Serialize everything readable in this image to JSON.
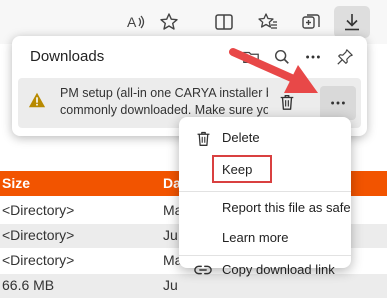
{
  "toolbar": {
    "icons": [
      "read-aloud-icon",
      "favorite-star-icon",
      "split-screen-icon",
      "favorites-icon",
      "collections-icon",
      "downloads-icon"
    ]
  },
  "downloads": {
    "title": "Downloads",
    "item": {
      "line1": "PM setup (all-in one CARYA installer ba",
      "line2": "commonly downloaded. Make sure you"
    }
  },
  "menu": {
    "delete": "Delete",
    "keep": "Keep",
    "report": "Report this file as safe",
    "learn_more": "Learn more",
    "copy_link": "Copy download link"
  },
  "table": {
    "headers": [
      "Size",
      "Da"
    ],
    "rows": [
      {
        "size": "<Directory>",
        "date": "Ma"
      },
      {
        "size": "<Directory>",
        "date": "Ju"
      },
      {
        "size": "<Directory>",
        "date": "Ma"
      },
      {
        "size": "66.6 MB",
        "date": "Ju"
      }
    ]
  },
  "colors": {
    "accent_orange": "#f25400",
    "highlight_red": "#d94040",
    "warning": "#b88a00"
  }
}
